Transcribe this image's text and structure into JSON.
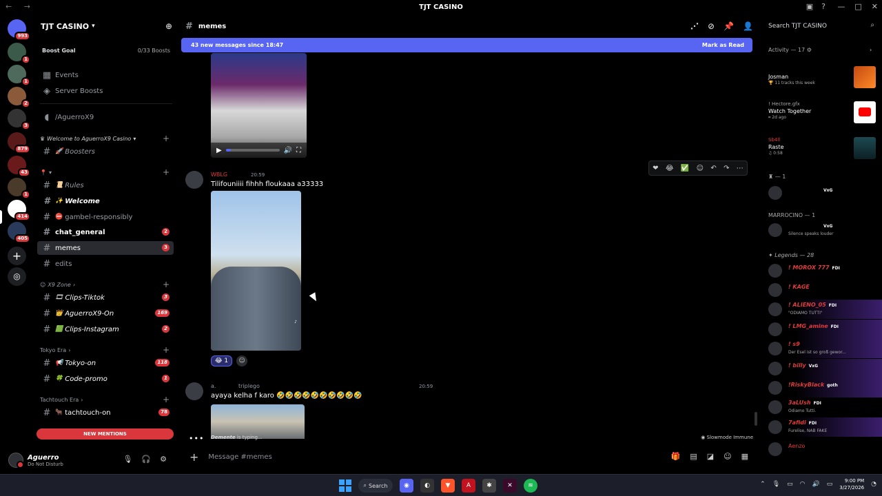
{
  "window": {
    "title": "TJT CASINO",
    "back": "←",
    "forward": "→"
  },
  "server_rail": {
    "badges": [
      "993",
      "1",
      "1",
      "2",
      "3",
      "879",
      "43",
      "1",
      "414",
      "405"
    ]
  },
  "guild": {
    "name": "TJT CASINO",
    "boost_goal": "Boost Goal",
    "boost_count": "0/33 Boosts",
    "events": "Events",
    "server_boosts": "Server Boosts",
    "voice_channel": "/AguerroX9"
  },
  "categories": {
    "welcome": "Welcome to AguerroX9 Casino",
    "x9_zone": "X9 Zone",
    "tokyo_era": "Tokyo Era",
    "tachtouch_era": "Tachtouch Era"
  },
  "channels": [
    {
      "name": "Boosters",
      "badge": ""
    },
    {
      "name": "Rules",
      "badge": ""
    },
    {
      "name": "Welcome",
      "badge": ""
    },
    {
      "name": "gambel-responsibly",
      "badge": ""
    },
    {
      "name": "chat_general",
      "badge": "2"
    },
    {
      "name": "memes",
      "badge": "3"
    },
    {
      "name": "edits",
      "badge": ""
    },
    {
      "name": "Clips-Tiktok",
      "badge": "3"
    },
    {
      "name": "AguerroX9-On",
      "badge": "169"
    },
    {
      "name": "Clips-Instagram",
      "badge": "2"
    },
    {
      "name": "Tokyo-on",
      "badge": "118"
    },
    {
      "name": "Code-promo",
      "badge": "1"
    },
    {
      "name": "tachtouch-on",
      "badge": "78"
    }
  ],
  "new_mentions": "NEW MENTIONS",
  "user": {
    "name": "Aguerro",
    "status": "Do Not Disturb"
  },
  "channel_header": {
    "name": "memes"
  },
  "new_messages_bar": {
    "text": "43 new messages since 18:47",
    "mark_read": "Mark as Read"
  },
  "messages": [
    {
      "author": "WBLG",
      "time": "20:59",
      "text": "Tilifouniiii fihhh floukaaa a33333",
      "reaction_count": "1"
    },
    {
      "author": "triplego",
      "prefix": "a.",
      "time": "20:59",
      "text": "ayaya kelha f karo 🤣🤣🤣🤣🤣🤣🤣🤣🤣🤣"
    }
  ],
  "typing": {
    "who": "Demente",
    "suffix": "is typing..."
  },
  "slowmode": "Slowmode Immune",
  "composer": {
    "placeholder": "Message #memes"
  },
  "members_panel": {
    "search_placeholder": "Search TJT CASINO",
    "activity_header": "Activity — 17",
    "activities": [
      {
        "title": "Josman",
        "sub": "11 tracks this week"
      },
      {
        "who": "! Hectore.gfx",
        "title": "Watch Together",
        "sub": "2d ago"
      },
      {
        "who": "Sb4ll",
        "title": "Raste",
        "sub": "0:58"
      }
    ],
    "groups": [
      {
        "header": "— 1"
      },
      {
        "header": "MARROCINO — 1"
      },
      {
        "header": "Legends — 28"
      }
    ],
    "members": [
      {
        "name": "",
        "status": "",
        "tag": "VxG"
      },
      {
        "name": "",
        "status": "Silence speaks louder",
        "tag": "VxG"
      },
      {
        "name": "! MOROX 777",
        "status": "",
        "tag": "FDI"
      },
      {
        "name": "! KAGE",
        "status": "",
        "tag": ""
      },
      {
        "name": "! ALIENO_05",
        "status": "\"ODIAMO TUTTI\"",
        "tag": "FDI"
      },
      {
        "name": "! LMG_amine",
        "status": "",
        "tag": "FDI"
      },
      {
        "name": "! s9",
        "status": "Der Esel ist so groß gewor...",
        "tag": ""
      },
      {
        "name": "! billy",
        "status": "",
        "tag": "VxG"
      },
      {
        "name": "!RiskyBlack",
        "status": "",
        "tag": "goth"
      },
      {
        "name": "3aLUsh",
        "status": "Odiamo Tutti.",
        "tag": "FDI"
      },
      {
        "name": "7afidi",
        "status": "Furelise, NAB FAKE",
        "tag": "FDI"
      },
      {
        "name": "Aenzo",
        "status": "",
        "tag": ""
      }
    ]
  },
  "taskbar": {
    "search": "Search",
    "time": "9:00 PM",
    "date": "3/27/2026"
  },
  "colors": {
    "accent": "#5865f2",
    "danger": "#da373c",
    "role_red": "#e23b3b"
  }
}
